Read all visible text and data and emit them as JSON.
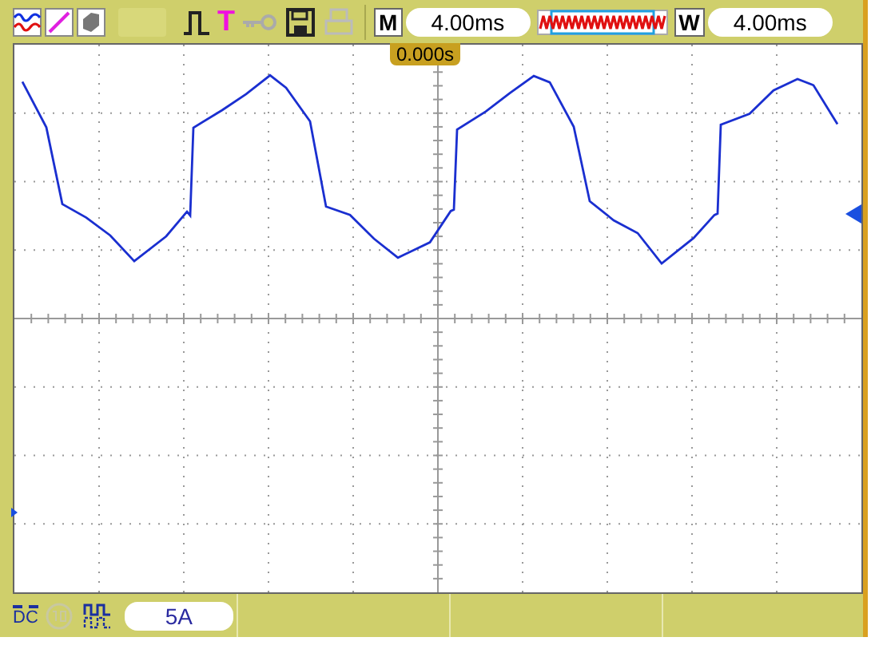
{
  "top_bar": {
    "trigger_label": "T",
    "main_timebase": {
      "label": "M",
      "value": "4.00ms"
    },
    "window_timebase": {
      "label": "W",
      "value": "4.00ms"
    }
  },
  "display": {
    "trigger_time": "0.000s"
  },
  "bottom_bar": {
    "coupling": "DC",
    "scale": "5A"
  }
}
